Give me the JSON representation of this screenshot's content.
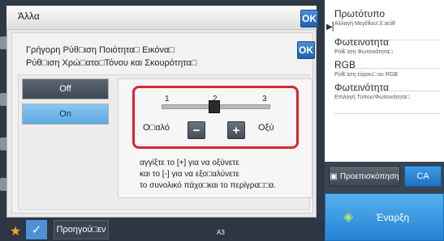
{
  "dialog": {
    "title": "Άλλα",
    "ok_label": "OK",
    "line1": "Γρήγορη Ρύθ□ιση Ποιότητα□ Εικόνα□",
    "line2": "Ρύθ□ιση Χρώ□ατο□Τόνου και Σκουρότητα□",
    "ok2_label": "OK"
  },
  "options": {
    "off": "Off",
    "on": "On",
    "selected": "On"
  },
  "sharpness": {
    "ticks": [
      "1",
      "2",
      "3"
    ],
    "value": 2,
    "min": 1,
    "max": 3,
    "left_label": "Ο□αλό",
    "right_label": "Οξύ",
    "minus": "−",
    "plus": "+",
    "desc1": "αγγίξτε το [+] για να οξύνετε",
    "desc2": "και το [-] για να εξο□αλύνετε",
    "desc3": "το συνολικό πάχο□και το περίγρα□□α."
  },
  "side_panel": {
    "items": [
      {
        "title": "Πρωτότυπο",
        "sub": "Αλλαγή Μεγέθου□/□ιεύθ"
      },
      {
        "title": "Φωτεινοτητα",
        "sub": "Ρύθ□ιση Φωτεινότητα□"
      },
      {
        "title": "RGB",
        "sub": "Ρύθ□ιση εύρου□ ου RGB"
      },
      {
        "title": "Φωτεινότητα",
        "sub": "Επιλογή Τύπου/Φωτεινότητα□"
      }
    ]
  },
  "actions": {
    "preview": "Προεπισκόπηση",
    "ca": "CA",
    "start": "Έναρξη",
    "back": "Προηγού□εν",
    "paper": "A3"
  },
  "colors": {
    "accent": "#2383d4",
    "highlight": "#d8262e"
  }
}
